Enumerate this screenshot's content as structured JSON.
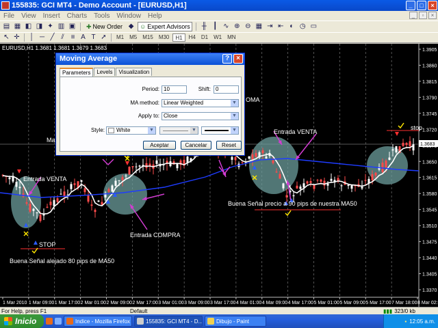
{
  "window": {
    "title": "155835: GCI MT4 - Demo Account - [EURUSD,H1]"
  },
  "menu": [
    "File",
    "View",
    "Insert",
    "Charts",
    "Tools",
    "Window",
    "Help"
  ],
  "toolbar": {
    "new_order": "New Order",
    "expert_advisors": "Expert Advisors"
  },
  "timeframes": [
    "M1",
    "M5",
    "M15",
    "M30",
    "H1",
    "H4",
    "D1",
    "W1",
    "MN"
  ],
  "active_timeframe": "H1",
  "chart": {
    "symbol_info": "EURUSD,H1  1.3681 1.3681 1.3679 1.3683",
    "current_price_label": "1.3683",
    "price_axis": [
      "1.3905",
      "1.3860",
      "1.3815",
      "1.3790",
      "1.3745",
      "1.3720",
      "1.3675",
      "1.3650",
      "1.3615",
      "1.3580",
      "1.3545",
      "1.3510",
      "1.3475",
      "1.3440",
      "1.3405",
      "1.3370"
    ],
    "time_axis": [
      "1 Mar 2010",
      "1 Mar 09:00",
      "1 Mar 17:00",
      "2 Mar 01:00",
      "2 Mar 09:00",
      "2 Mar 17:00",
      "3 Mar 01:00",
      "3 Mar 09:00",
      "3 Mar 17:00",
      "4 Mar 01:00",
      "4 Mar 09:00",
      "4 Mar 17:00",
      "5 Mar 01:00",
      "5 Mar 09:00",
      "5 Mar 17:00",
      "7 Mar 18:00",
      "8 Mar 02:00"
    ],
    "annotations": {
      "entrada_venta_1": "Entrada VENTA",
      "stop_1": "STOP",
      "buena_senal_1": "Buena Señal alejado 80 pips de MA50",
      "entrada_compra": "Entrada COMPRA",
      "entrada_venta_2": "Entrada VENTA",
      "buena_senal_2": "Buena Señal precio a 90 pips de nuestra MA50",
      "stop_2": "stop",
      "ma_label_fragment": "Ma",
      "ma_label_fragment_2": "OMA"
    },
    "colors": {
      "background": "#000000",
      "ma50": "#1e3cff",
      "ma_fast": "#ffffff",
      "bull": "#ffffff",
      "bear": "#ff4b4b",
      "highlight": "#6c9e9c",
      "arrows": "#d23cd2"
    }
  },
  "dialog": {
    "title": "Moving Average",
    "tabs": [
      "Parameters",
      "Levels",
      "Visualization"
    ],
    "period_label": "Period:",
    "period_value": "10",
    "shift_label": "Shift:",
    "shift_value": "0",
    "ma_method_label": "MA method:",
    "ma_method_value": "Linear Weighted",
    "apply_to_label": "Apply to:",
    "apply_to_value": "Close",
    "style_label": "Style:",
    "style_color": "White",
    "ok": "Aceptar",
    "cancel": "Cancelar",
    "reset": "Reset"
  },
  "status": {
    "help": "For Help, press F1",
    "profile": "Default",
    "traffic": "323/0 kb"
  },
  "taskbar": {
    "start": "Inicio",
    "tasks": [
      "Indice - Mozilla Firefox",
      "155835: GCI MT4 - D...",
      "Dibujo - Paint"
    ],
    "clock": "12:05 a.m."
  }
}
